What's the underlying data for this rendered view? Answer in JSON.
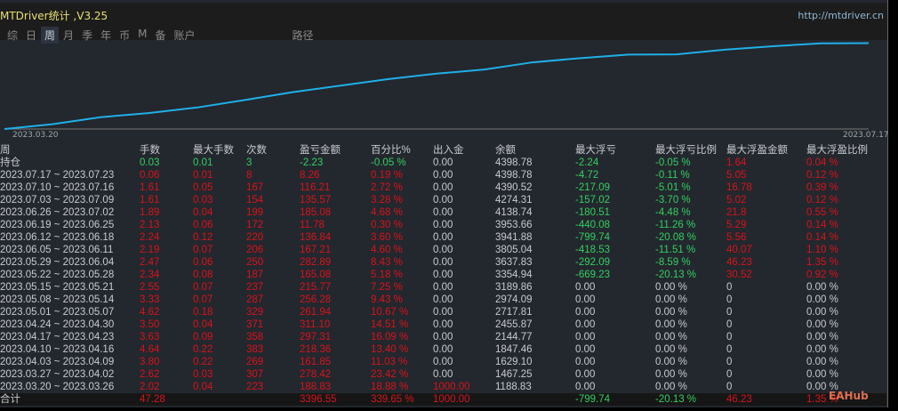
{
  "title": "MTDriver统计 ,V3.25",
  "url": "http://mtdriver.cn",
  "tabs": [
    "综",
    "日",
    "周",
    "月",
    "季",
    "年",
    "币",
    "M",
    "备",
    "账户",
    "路径"
  ],
  "active_tab": "周",
  "chart": {
    "start_label": "2023.03.20",
    "end_label": "2023.07.17",
    "line_color": "#1fb0e8"
  },
  "columns": [
    "周",
    "手数",
    "最大手数",
    "次数",
    "盈亏金额",
    "百分比%",
    "出入金",
    "余额",
    "最大浮亏",
    "最大浮亏比例",
    "最大浮盈金额",
    "最大浮盈比例"
  ],
  "position_row": [
    "持仓",
    "0.03",
    "0.01",
    "3",
    "-2.23",
    "-0.05 %",
    "0.00",
    "4398.78",
    "-2.24",
    "-0.05 %",
    "1.64",
    "0.04 %"
  ],
  "rows": [
    [
      "2023.07.17 ~ 2023.07.23",
      "0.06",
      "0.01",
      "8",
      "8.26",
      "0.19 %",
      "0.00",
      "4398.78",
      "-4.72",
      "-0.11 %",
      "5.05",
      "0.12 %"
    ],
    [
      "2023.07.10 ~ 2023.07.16",
      "1.61",
      "0.05",
      "167",
      "116.21",
      "2.72 %",
      "0.00",
      "4390.52",
      "-217.09",
      "-5.01 %",
      "16.78",
      "0.39 %"
    ],
    [
      "2023.07.03 ~ 2023.07.09",
      "1.61",
      "0.03",
      "154",
      "135.57",
      "3.28 %",
      "0.00",
      "4274.31",
      "-157.02",
      "-3.70 %",
      "5.02",
      "0.12 %"
    ],
    [
      "2023.06.26 ~ 2023.07.02",
      "1.89",
      "0.04",
      "199",
      "185.08",
      "4.68 %",
      "0.00",
      "4138.74",
      "-180.51",
      "-4.48 %",
      "21.8",
      "0.55 %"
    ],
    [
      "2023.06.19 ~ 2023.06.25",
      "2.13",
      "0.06",
      "172",
      "11.78",
      "0.30 %",
      "0.00",
      "3953.66",
      "-440.08",
      "-11.26 %",
      "5.29",
      "0.14 %"
    ],
    [
      "2023.06.12 ~ 2023.06.18",
      "2.24",
      "0.12",
      "220",
      "136.84",
      "3.60 %",
      "0.00",
      "3941.88",
      "-799.74",
      "-20.08 %",
      "5.56",
      "0.14 %"
    ],
    [
      "2023.06.05 ~ 2023.06.11",
      "2.19",
      "0.07",
      "206",
      "167.21",
      "4.60 %",
      "0.00",
      "3805.04",
      "-418.53",
      "-11.51 %",
      "40.07",
      "1.10 %"
    ],
    [
      "2023.05.29 ~ 2023.06.04",
      "2.47",
      "0.06",
      "250",
      "282.89",
      "8.43 %",
      "0.00",
      "3637.83",
      "-292.09",
      "-8.59 %",
      "46.23",
      "1.35 %"
    ],
    [
      "2023.05.22 ~ 2023.05.28",
      "2.34",
      "0.08",
      "187",
      "165.08",
      "5.18 %",
      "0.00",
      "3354.94",
      "-669.23",
      "-20.13 %",
      "30.52",
      "0.92 %"
    ],
    [
      "2023.05.15 ~ 2023.05.21",
      "2.55",
      "0.07",
      "237",
      "215.77",
      "7.25 %",
      "0.00",
      "3189.86",
      "0.00",
      "0.00 %",
      "0",
      "0.00 %"
    ],
    [
      "2023.05.08 ~ 2023.05.14",
      "3.33",
      "0.07",
      "287",
      "256.28",
      "9.43 %",
      "0.00",
      "2974.09",
      "0.00",
      "0.00 %",
      "0",
      "0.00 %"
    ],
    [
      "2023.05.01 ~ 2023.05.07",
      "4.62",
      "0.18",
      "329",
      "261.94",
      "10.67 %",
      "0.00",
      "2717.81",
      "0.00",
      "0.00 %",
      "0",
      "0.00 %"
    ],
    [
      "2023.04.24 ~ 2023.04.30",
      "3.50",
      "0.04",
      "371",
      "311.10",
      "14.51 %",
      "0.00",
      "2455.87",
      "0.00",
      "0.00 %",
      "0",
      "0.00 %"
    ],
    [
      "2023.04.17 ~ 2023.04.23",
      "3.63",
      "0.09",
      "358",
      "297.31",
      "16.09 %",
      "0.00",
      "2144.77",
      "0.00",
      "0.00 %",
      "0",
      "0.00 %"
    ],
    [
      "2023.04.10 ~ 2023.04.16",
      "4.64",
      "0.22",
      "383",
      "218.36",
      "13.40 %",
      "0.00",
      "1847.46",
      "0.00",
      "0.00 %",
      "0",
      "0.00 %"
    ],
    [
      "2023.04.03 ~ 2023.04.09",
      "3.80",
      "0.22",
      "269",
      "161.85",
      "11.03 %",
      "0.00",
      "1629.10",
      "0.00",
      "0.00 %",
      "0",
      "0.00 %"
    ],
    [
      "2023.03.27 ~ 2023.04.02",
      "2.62",
      "0.03",
      "307",
      "278.42",
      "23.42 %",
      "0.00",
      "1467.25",
      "0.00",
      "0.00 %",
      "0",
      "0.00 %"
    ],
    [
      "2023.03.20 ~ 2023.03.26",
      "2.02",
      "0.04",
      "223",
      "188.83",
      "18.88 %",
      "1000.00",
      "1188.83",
      "0.00",
      "0.00 %",
      "0",
      "0.00 %"
    ]
  ],
  "total_row": [
    "合计",
    "47.28",
    "",
    "",
    "3396.55",
    "339.65 %",
    "1000.00",
    "",
    "-799.74",
    "-20.13 %",
    "46.23",
    "1.35 %"
  ],
  "watermark": "EAHub"
}
